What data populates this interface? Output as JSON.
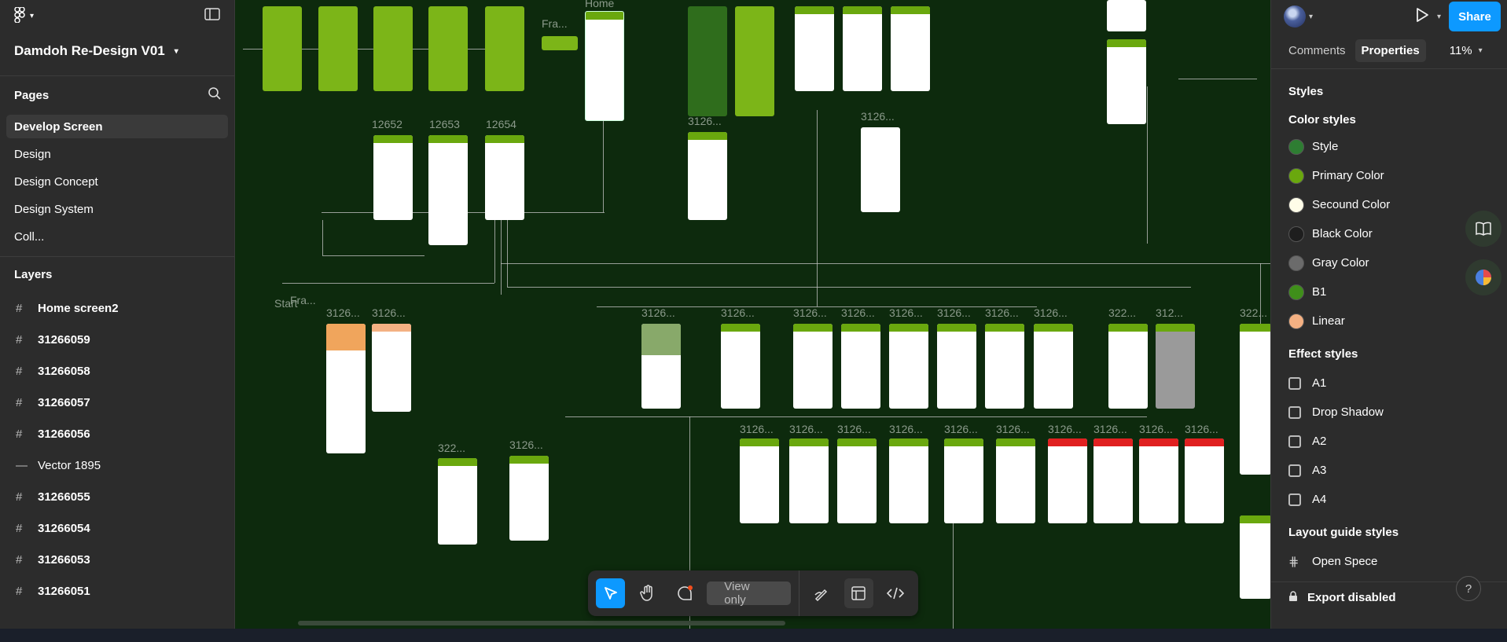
{
  "project": {
    "title": "Damdoh Re-Design V01"
  },
  "pages": {
    "heading": "Pages",
    "items": [
      "Develop Screen",
      "Design",
      "Design Concept",
      "Design System",
      "Coll..."
    ]
  },
  "layers": {
    "heading": "Layers",
    "items": [
      {
        "icon": "#",
        "label": "Home screen2"
      },
      {
        "icon": "#",
        "label": "31266059"
      },
      {
        "icon": "#",
        "label": "31266058"
      },
      {
        "icon": "#",
        "label": "31266057"
      },
      {
        "icon": "#",
        "label": "31266056"
      },
      {
        "icon": "—",
        "label": "Vector 1895"
      },
      {
        "icon": "#",
        "label": "31266055"
      },
      {
        "icon": "#",
        "label": "31266054"
      },
      {
        "icon": "#",
        "label": "31266053"
      },
      {
        "icon": "#",
        "label": "31266051"
      }
    ]
  },
  "right_panel": {
    "share_label": "Share",
    "tab_comments": "Comments",
    "tab_properties": "Properties",
    "zoom": "11%",
    "styles_heading": "Styles",
    "color_styles_heading": "Color styles",
    "color_styles": [
      {
        "label": "Style",
        "color": "#2e7d32"
      },
      {
        "label": "Primary Color",
        "color": "#6aa80e"
      },
      {
        "label": "Secound Color",
        "color": "#fffde8"
      },
      {
        "label": "Black Color",
        "color": "#1e1e1e"
      },
      {
        "label": "Gray Color",
        "color": "#6b6b6b"
      },
      {
        "label": "B1",
        "color": "#3f8f1a"
      },
      {
        "label": "Linear",
        "color": "#f4b183"
      }
    ],
    "effect_styles_heading": "Effect styles",
    "effect_styles": [
      "A1",
      "Drop Shadow",
      "A2",
      "A3",
      "A4"
    ],
    "layout_guide_heading": "Layout guide styles",
    "layout_guides": [
      "Open Spece"
    ],
    "export_label": "Export disabled"
  },
  "toolbar": {
    "view_only": "View only"
  },
  "canvas": {
    "frame_labels": [
      "Fra...",
      "Home",
      "12652",
      "12653",
      "12654",
      "3126...",
      "3126...",
      "Start",
      "Fra...",
      "3126...",
      "3126...",
      "3126...",
      "3126...",
      "3126...",
      "3126...",
      "3126...",
      "3126...",
      "3126...",
      "3126...",
      "322...",
      "312...",
      "322...",
      "322...",
      "3126...",
      "3126...",
      "3126...",
      "3126...",
      "3126...",
      "3126...",
      "3126...",
      "3126...",
      "3126...",
      "3126...",
      "3126..."
    ]
  },
  "colors": {
    "canvas_bg": "#0d2a0d",
    "accent": "#0d99ff",
    "panel_bg": "#2c2c2c",
    "brand_green": "#7cb518"
  }
}
